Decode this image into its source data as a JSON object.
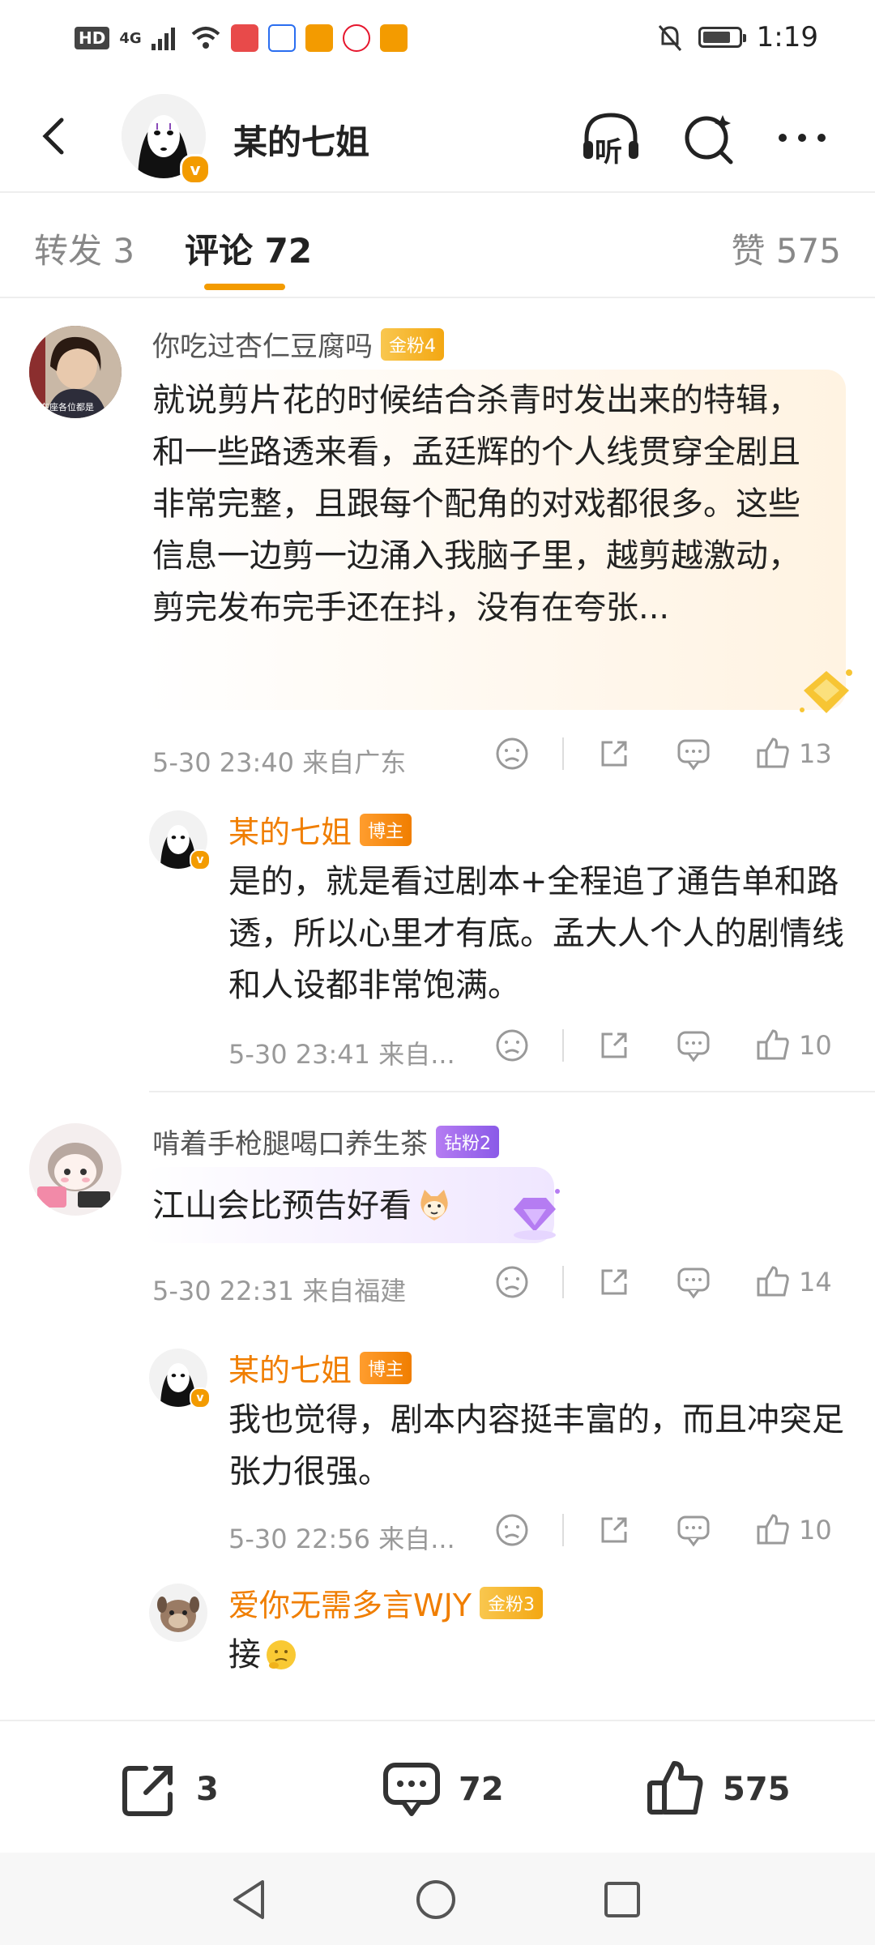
{
  "status_bar": {
    "hd": "HD",
    "network": "4G",
    "time": "1:19"
  },
  "header": {
    "title": "某的七姐",
    "listen_label": "听"
  },
  "tabs": [
    {
      "label": "转发 3"
    },
    {
      "label": "评论 72"
    },
    {
      "label": "赞 575"
    }
  ],
  "comments": [
    {
      "user": "你吃过杏仁豆腐吗",
      "badge": "金粉4",
      "text": "就说剪片花的时候结合杀青时发出来的特辑，和一些路透来看，孟廷辉的个人线贯穿全剧且非常完整，且跟每个配角的对戏都很多。这些信息一边剪一边涌入我脑子里，越剪越激动，剪完发布完手还在抖，没有在夸张...",
      "meta": "5-30 23:40  来自广东",
      "likes": "13",
      "avatar_caption": "在座各位都是"
    },
    {
      "user": "某的七姐",
      "badge": "博主",
      "text": "是的，就是看过剧本+全程追了通告单和路透，所以心里才有底。孟大人个人的剧情线和人设都非常饱满。",
      "meta": "5-30 23:41  来自...",
      "likes": "10"
    },
    {
      "user": "啃着手枪腿喝口养生茶",
      "badge": "钻粉2",
      "text": "江山会比预告好看",
      "meta": "5-30 22:31  来自福建",
      "likes": "14"
    },
    {
      "user": "某的七姐",
      "badge": "博主",
      "text": "我也觉得，剧本内容挺丰富的，而且冲突足张力很强。",
      "meta": "5-30 22:56  来自...",
      "likes": "10"
    },
    {
      "user": "爱你无需多言WJY",
      "badge": "金粉3",
      "text": "接"
    }
  ],
  "bottom_bar": {
    "repost_count": "3",
    "comment_count": "72",
    "like_count": "575"
  },
  "colors": {
    "accent": "#f39b00",
    "name_orange": "#f07e00"
  }
}
